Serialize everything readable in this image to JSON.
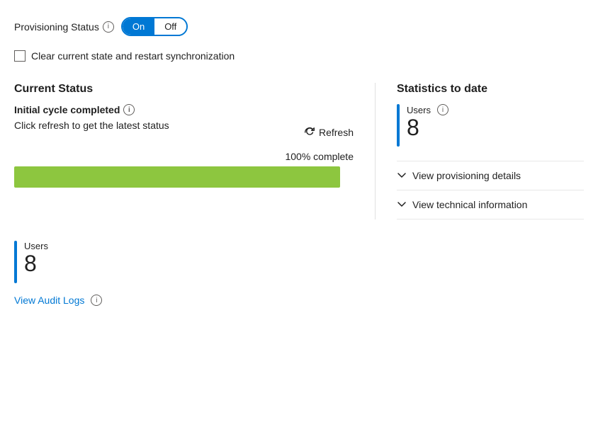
{
  "provisioning": {
    "status_label": "Provisioning Status",
    "toggle_on": "On",
    "toggle_off": "Off",
    "checkbox_label": "Clear current state and restart synchronization"
  },
  "current_status": {
    "section_title": "Current Status",
    "cycle_label": "Initial cycle completed",
    "description": "Click refresh to get the latest status",
    "refresh_label": "Refresh",
    "progress_percent": "100% complete",
    "progress_value": 100
  },
  "statistics": {
    "section_title": "Statistics to date",
    "users_label": "Users",
    "users_count": "8"
  },
  "expandable": {
    "provisioning_details": "View provisioning details",
    "technical_info": "View technical information"
  },
  "bottom": {
    "users_label": "Users",
    "users_count": "8",
    "audit_link": "View Audit Logs"
  },
  "icons": {
    "info": "i",
    "chevron_down": "∨",
    "refresh_symbol": "↺"
  }
}
